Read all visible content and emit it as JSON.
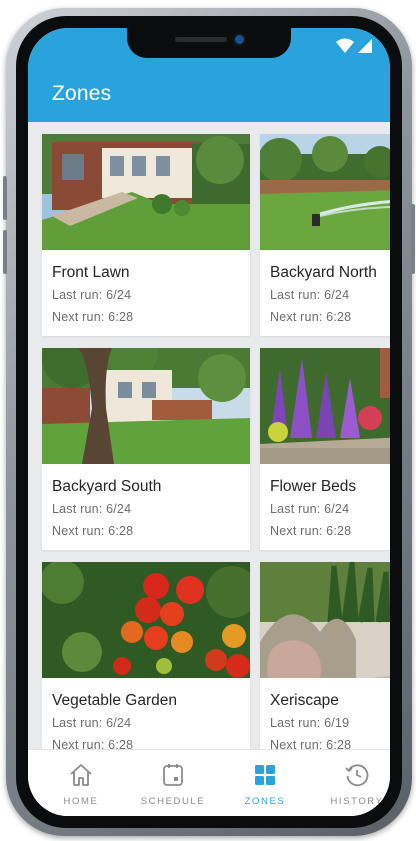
{
  "header": {
    "title": "Zones",
    "accent_color": "#2aa3dd",
    "status_icons": [
      "wifi-icon",
      "signal-icon"
    ]
  },
  "zones": [
    {
      "name": "Front Lawn",
      "last_run": "Last run: 6/24",
      "next_run": "Next run: 6:28",
      "image": "house-front-lawn"
    },
    {
      "name": "Backyard North",
      "last_run": "Last run: 6/24",
      "next_run": "Next run: 6:28",
      "image": "sprinkler-lawn"
    },
    {
      "name": "Backyard South",
      "last_run": "Last run: 6/24",
      "next_run": "Next run: 6:28",
      "image": "tree-backyard"
    },
    {
      "name": "Flower Beds",
      "last_run": "Last run: 6/24",
      "next_run": "Next run: 6:28",
      "image": "purple-flowers"
    },
    {
      "name": "Vegetable Garden",
      "last_run": "Last run: 6/24",
      "next_run": "Next run: 6:28",
      "image": "tomatoes"
    },
    {
      "name": "Xeriscape",
      "last_run": "Last run: 6/19",
      "next_run": "Next run: 6:28",
      "image": "grasses-rocks"
    }
  ],
  "nav": {
    "items": [
      {
        "label": "HOME",
        "icon": "home-icon",
        "active": false
      },
      {
        "label": "SCHEDULE",
        "icon": "calendar-icon",
        "active": false
      },
      {
        "label": "ZONES",
        "icon": "grid-icon",
        "active": true
      },
      {
        "label": "HISTORY",
        "icon": "history-icon",
        "active": false
      }
    ]
  }
}
